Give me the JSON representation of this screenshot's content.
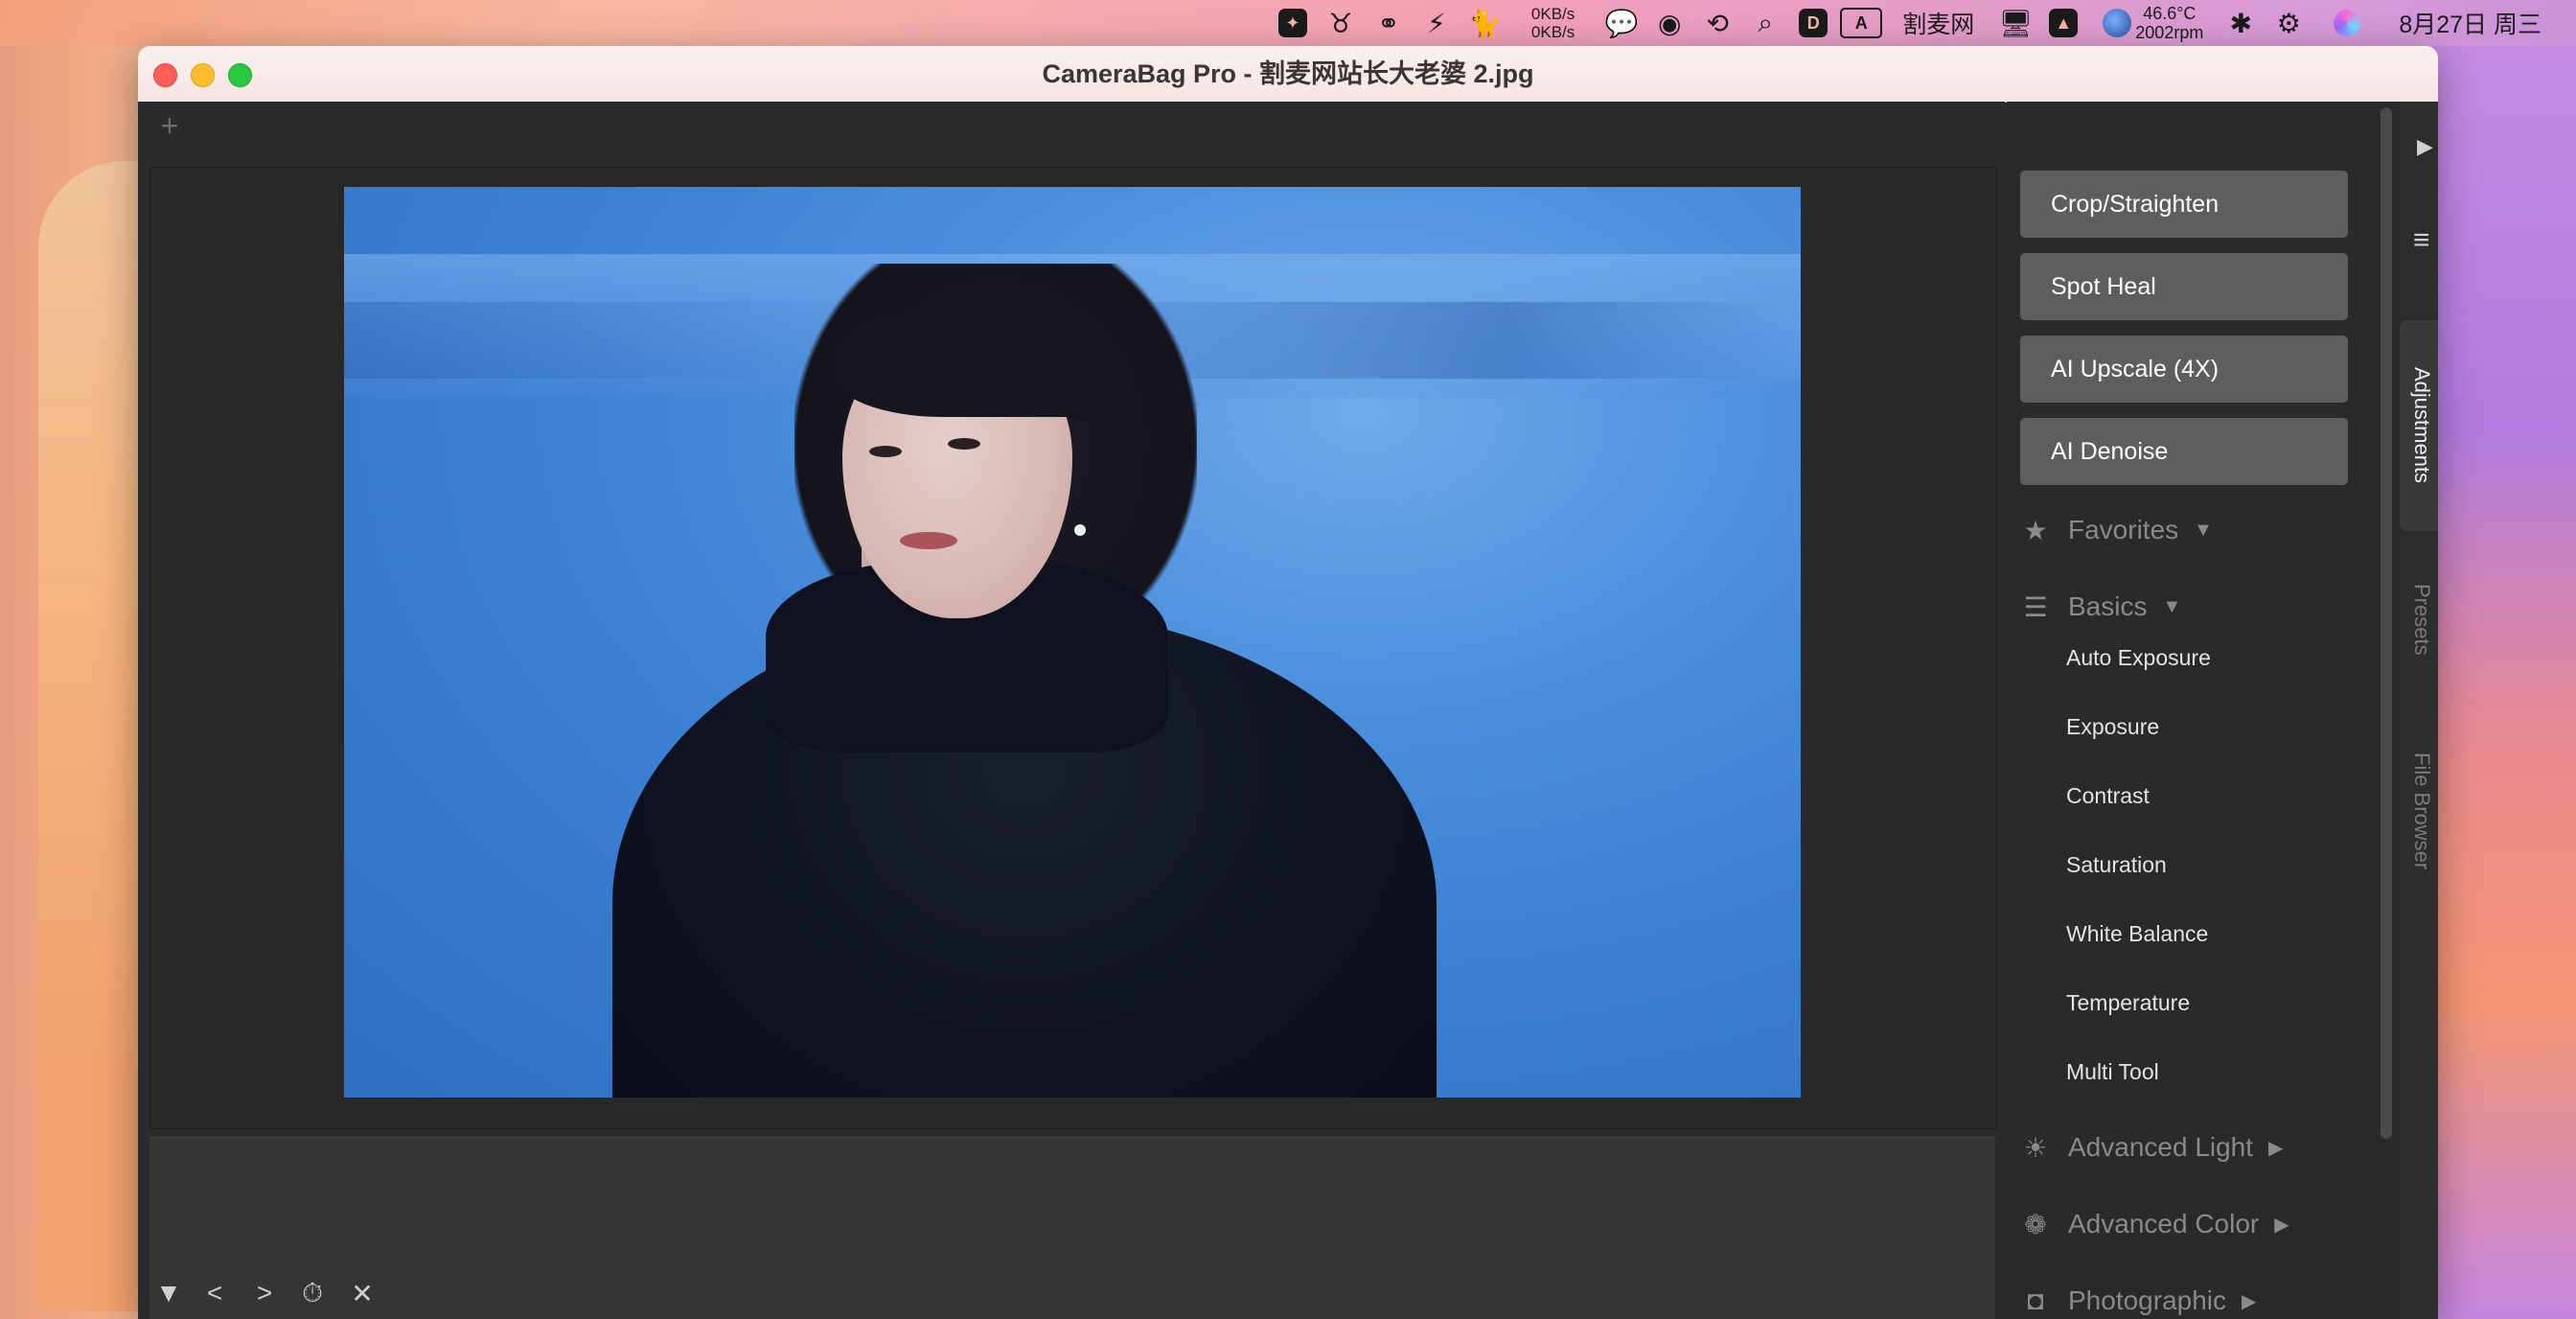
{
  "menubar": {
    "netspeed": {
      "up": "0KB/s",
      "down": "0KB/s"
    },
    "ai_box": "A",
    "site_name": "割麦网",
    "temperature": {
      "temp": "46.6°C",
      "fan": "2002rpm"
    },
    "date": "8月27日 周三"
  },
  "window": {
    "title": "CameraBag Pro - 割麦网站长大老婆 2.jpg"
  },
  "toolbar": {
    "add_label": "+"
  },
  "filmstrip": {
    "collapse": "▼",
    "prev": "<",
    "next": ">",
    "history": "⏱",
    "close": "✕"
  },
  "panel": {
    "tools": [
      "Crop/Straighten",
      "Spot Heal",
      "AI Upscale (4X)",
      "AI Denoise"
    ],
    "sections": {
      "favorites": "Favorites",
      "basics": "Basics",
      "advanced_light": "Advanced Light",
      "advanced_color": "Advanced Color",
      "photographic": "Photographic"
    },
    "basics_items": [
      "Auto Exposure",
      "Exposure",
      "Contrast",
      "Saturation",
      "White Balance",
      "Temperature",
      "Multi Tool"
    ],
    "tabs": {
      "adjustments": "Adjustments",
      "presets": "Presets",
      "file_browser": "File Browser"
    }
  }
}
